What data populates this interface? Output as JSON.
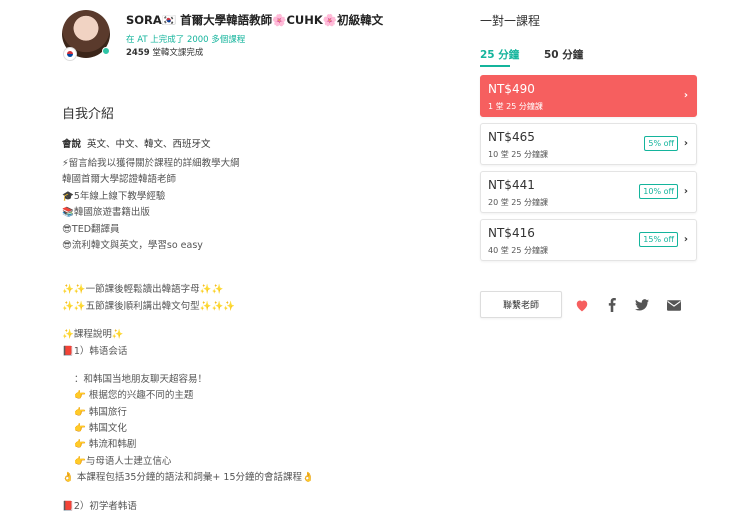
{
  "teacher": {
    "name": "SORA🇰🇷 首爾大學韓語教師🌸CUHK🌸初級韓文",
    "subtitle": "在 AT 上完成了 2000 多個課程",
    "lessons_count": "2459",
    "lessons_label": "堂韓文課完成"
  },
  "intro": {
    "title": "自我介紹",
    "languages_label": "會說",
    "languages": "英文、中文、韓文、西班牙文",
    "lines": [
      "⚡留言給我以獲得關於課程的詳細教學大綱",
      "󠁿韓國首爾大學認證韓語老師",
      "🎓5年線上線下教學經驗",
      "📚韓國旅遊書籍出版",
      "😎TED翻譯員",
      "😎流利韓文與英文，學習so easy"
    ],
    "sparkle_lines": [
      "✨✨一節課後輕鬆讀出韓語字母✨✨",
      "✨✨五節課後順利講出韓文句型✨✨✨"
    ],
    "course_note_title": "✨課程說明✨",
    "course_1": "📕1）韩语会话",
    "course_1_intro": "：和韩国当地朋友聊天超容易！",
    "course_1_topics": [
      "👉 根据您的兴趣不同的主题",
      "👉 韩国旅行",
      "👉 韩国文化",
      "👉 韩流和韩剧",
      "👉与母语人士建立信心"
    ],
    "course_1_summary": "👌 本課程包括35分鐘的語法和詞彙+ 15分鐘的會話課程👌",
    "course_2": "📕2）初学者韩语"
  },
  "courses": {
    "title": "一對一課程",
    "tabs": [
      {
        "label": "25 分鐘",
        "active": true
      },
      {
        "label": "50 分鐘",
        "active": false
      }
    ],
    "packages": [
      {
        "price": "NT$490",
        "lessons": "1 堂 25 分鐘課",
        "discount": "",
        "active": true
      },
      {
        "price": "NT$465",
        "lessons": "10 堂 25 分鐘課",
        "discount": "5% off",
        "active": false
      },
      {
        "price": "NT$441",
        "lessons": "20 堂 25 分鐘課",
        "discount": "10% off",
        "active": false
      },
      {
        "price": "NT$416",
        "lessons": "40 堂 25 分鐘課",
        "discount": "15% off",
        "active": false
      }
    ],
    "contact_label": "聯繫老師"
  },
  "colors": {
    "accent": "#14b49c",
    "active_card": "#f65f5f",
    "heart": "#f65f5f",
    "social_icon": "#555555"
  },
  "icons": [
    "heart-icon",
    "facebook-icon",
    "twitter-icon",
    "email-icon",
    "chevron-right-icon"
  ]
}
